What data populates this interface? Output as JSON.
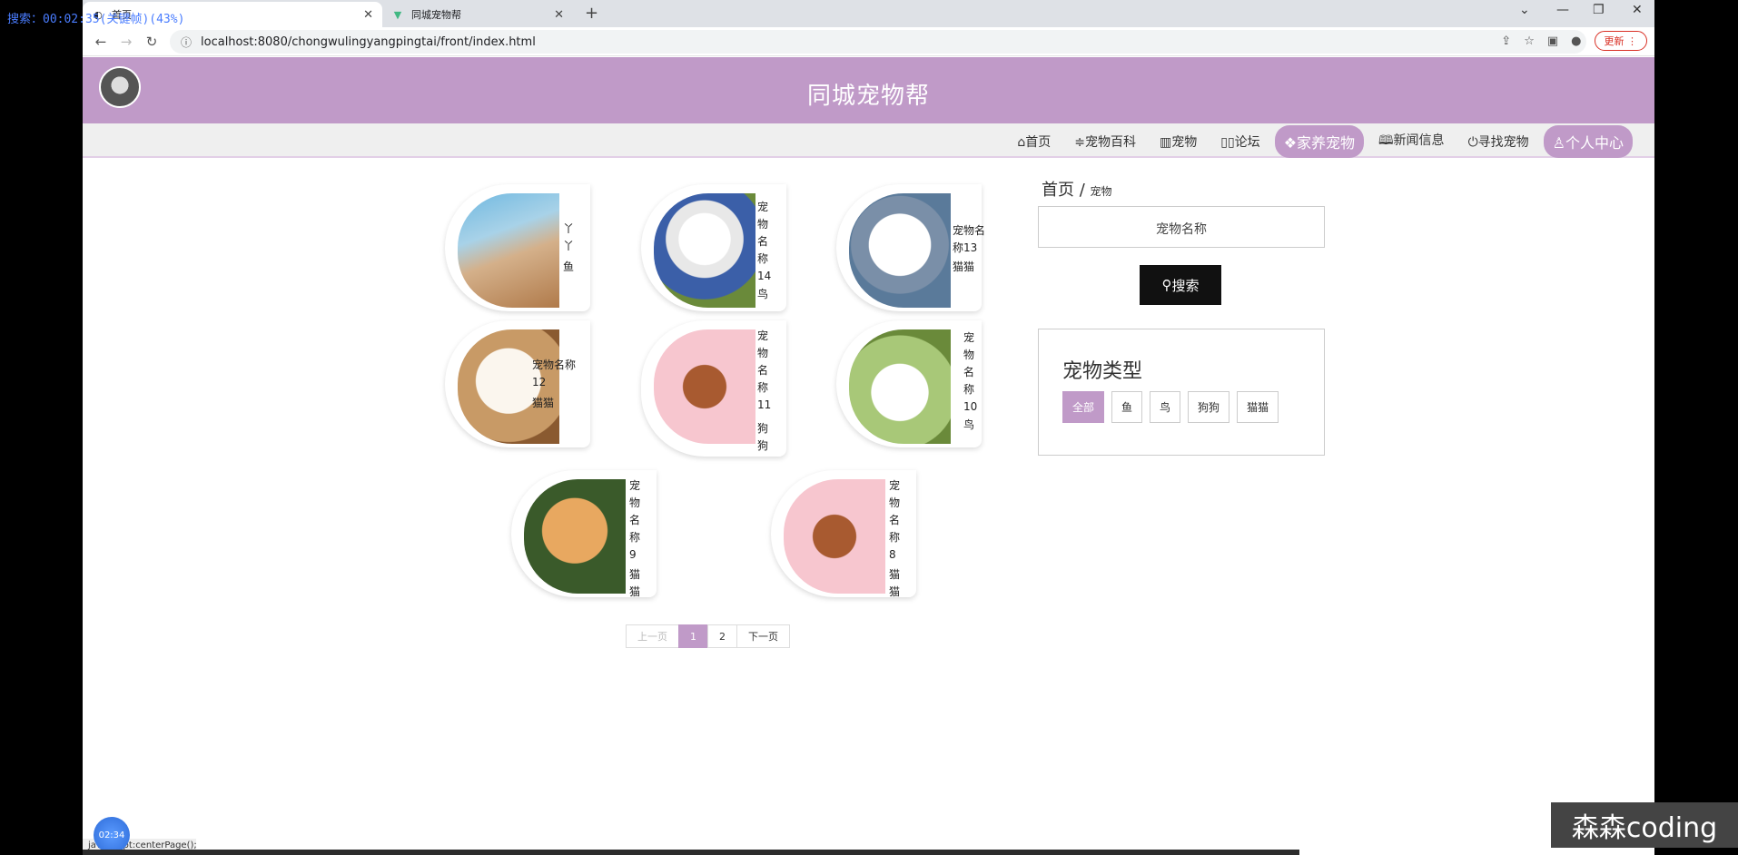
{
  "overlay": {
    "text": "搜索：00:02:35(关键帧)(43%)"
  },
  "browser": {
    "tabs": [
      {
        "label": "首页",
        "active": true
      },
      {
        "label": "同城宠物帮",
        "active": false
      }
    ],
    "new_tab": "+",
    "url": "localhost:8080/chongwulingyangpingtai/front/index.html",
    "update_label": "更新",
    "window_controls": [
      "⌄",
      "—",
      "❐",
      "✕"
    ]
  },
  "site": {
    "title": "同城宠物帮",
    "nav": [
      {
        "label": "⌂首页",
        "active": false
      },
      {
        "label": "≑宠物百科",
        "active": false
      },
      {
        "label": "▥宠物",
        "active": false
      },
      {
        "label": "▯▯论坛",
        "active": false
      },
      {
        "label": "❖家养宠物",
        "active": true
      },
      {
        "label": "🕮新闻信息",
        "active": false
      },
      {
        "label": "⏻寻找宠物",
        "active": false
      },
      {
        "label": "♙个人中心",
        "active": true
      }
    ]
  },
  "pets": [
    {
      "name": "丫丫",
      "type": "鱼"
    },
    {
      "name": "宠物名称14",
      "type": "鸟"
    },
    {
      "name": "宠物名称13",
      "type": "猫猫"
    },
    {
      "name": "宠物名称12",
      "type": "猫猫"
    },
    {
      "name": "宠物名称11",
      "type": "狗狗"
    },
    {
      "name": "宠物名称10",
      "type": "鸟"
    },
    {
      "name": "宠物名称9",
      "type": "猫猫"
    },
    {
      "name": "宠物名称8",
      "type": "猫猫"
    }
  ],
  "sidebar": {
    "breadcrumb_home": "首页",
    "breadcrumb_sep": "/",
    "breadcrumb_current": "宠物",
    "search_placeholder": "宠物名称",
    "search_button": "搜索",
    "types_title": "宠物类型",
    "types": [
      "全部",
      "鱼",
      "鸟",
      "狗狗",
      "猫猫"
    ]
  },
  "pagination": {
    "prev": "上一页",
    "pages": [
      "1",
      "2"
    ],
    "current": "1",
    "next": "下一页"
  },
  "status_bar": "javascript:centerPage();",
  "timer": "02:34",
  "watermark": "森森coding"
}
